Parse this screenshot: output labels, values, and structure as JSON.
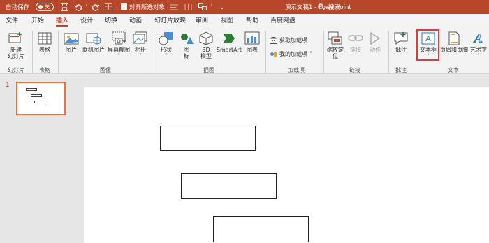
{
  "titlebar": {
    "autosave_label": "自动保存",
    "autosave_state": "关",
    "align_label": "对齐所选对象",
    "document_title": "演示文稿1  -  PowerPoint",
    "search_label": "搜索"
  },
  "tabs": [
    "文件",
    "开始",
    "插入",
    "设计",
    "切换",
    "动画",
    "幻灯片放映",
    "审阅",
    "视图",
    "帮助",
    "百度网盘",
    "搜索"
  ],
  "active_tab": "插入",
  "ribbon": {
    "slides": {
      "new_slide": "新建",
      "new_slide2": "幻灯片",
      "group": "幻灯片"
    },
    "tables": {
      "table": "表格",
      "group": "表格"
    },
    "images": {
      "picture": "图片",
      "online_picture": "联机图片",
      "screenshot": "屏幕截图",
      "album": "相册",
      "group": "图像"
    },
    "illustrations": {
      "shapes": "形状",
      "icons": "图",
      "icons2": "标",
      "model3d": "3D",
      "model3d2": "模型",
      "smartart": "SmartArt",
      "chart": "图表",
      "group": "插图"
    },
    "addins": {
      "get_addins": "获取加载项",
      "my_addins": "我的加载项",
      "group": "加载项"
    },
    "links": {
      "zoom": "缩放定",
      "zoom2": "位",
      "link": "链接",
      "action": "动作",
      "group": "链接"
    },
    "comments": {
      "comment": "批注",
      "group": "批注"
    },
    "text": {
      "textbox": "文本框",
      "header_footer": "页眉和页脚",
      "wordart": "艺术字",
      "group": "文本"
    }
  },
  "thumbnails": {
    "slide_number": "1"
  },
  "colors": {
    "accent": "#b7472a",
    "highlight": "#e53935",
    "thumb_border": "#e8743b"
  }
}
